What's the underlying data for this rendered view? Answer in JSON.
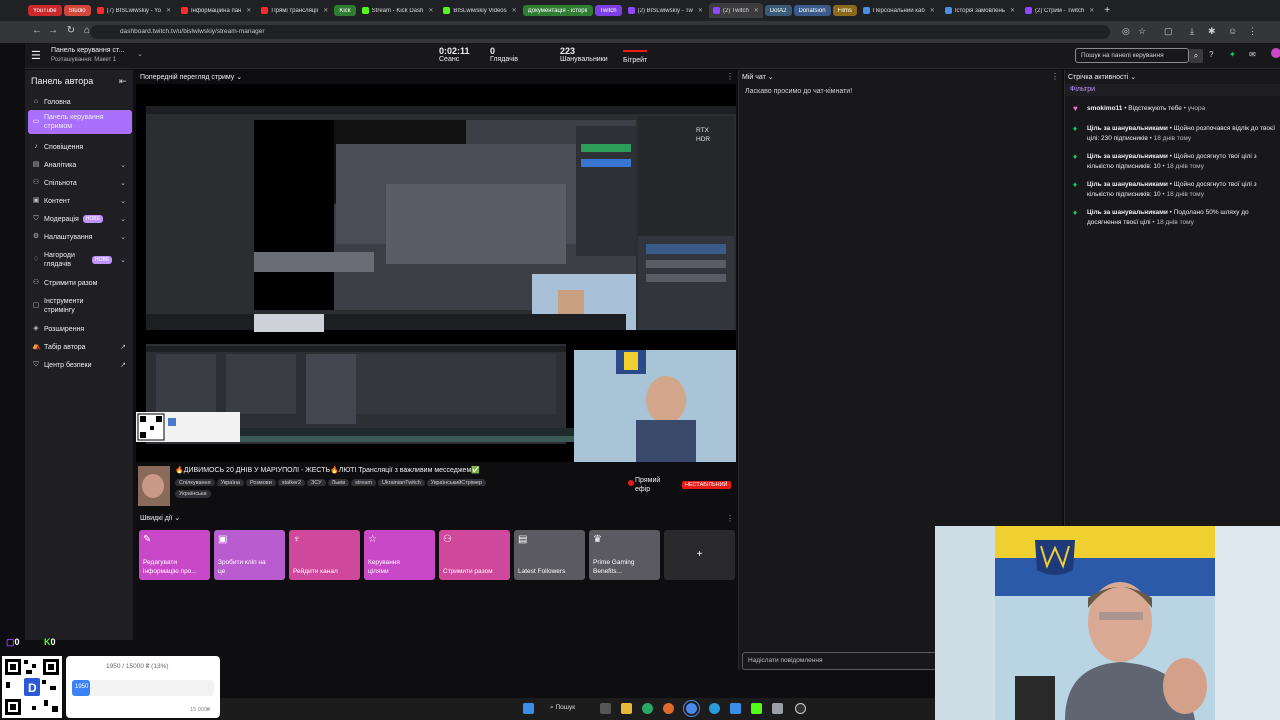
{
  "browser": {
    "tabs": [
      {
        "label": "YouTube",
        "pill": true,
        "color": "#cc2a2a"
      },
      {
        "label": "Studio",
        "pill": true,
        "color": "#d2463c"
      },
      {
        "label": "(7) BISLwiwskiy - Yo",
        "color": "#ff2a2a"
      },
      {
        "label": "Інформаційна пан",
        "color": "#ff2a2a"
      },
      {
        "label": "Прямі трансляції",
        "color": "#ff2a2a"
      },
      {
        "label": "Kick",
        "pill": true,
        "color": "#2e7d32"
      },
      {
        "label": "Stream - Kick Dash",
        "color": "#53fc18"
      },
      {
        "label": "BISLwiwskiy Videos",
        "color": "#53fc18"
      },
      {
        "label": "Документація - історії",
        "pill": true,
        "color": "#2e7d32"
      },
      {
        "label": "Twitch",
        "pill": true,
        "color": "#7b3fe4"
      },
      {
        "label": "(2) BISLwiwskiy - Tw",
        "color": "#9147ff"
      },
      {
        "label": "(2) Twitch",
        "color": "#9147ff",
        "active": true
      },
      {
        "label": "DotA2",
        "pill": true,
        "color": "#3a5a78"
      },
      {
        "label": "Donatsion",
        "pill": true,
        "color": "#3a5a8a"
      },
      {
        "label": "Films",
        "pill": true,
        "color": "#8a6a1a"
      },
      {
        "label": "Персональний каб",
        "color": "#4a90e2"
      },
      {
        "label": "Історія замовлень",
        "color": "#4a90e2"
      },
      {
        "label": "(2) Стрим - Twitch",
        "color": "#9147ff"
      }
    ],
    "url": "dashboard.twitch.tv/u/bislwiwskiy/stream-manager"
  },
  "header": {
    "panel_title": "Панель керування ст...",
    "layout": "Розташування: Макет 1",
    "stats": [
      {
        "value": "0:02:11",
        "label": "Сеанс"
      },
      {
        "value": "0",
        "label": "Глядачів"
      },
      {
        "value": "223",
        "label": "Шанувальники"
      },
      {
        "value": "",
        "label": "Бітрейт"
      }
    ],
    "search_placeholder": "Пошук на панелі керування"
  },
  "sidebar": {
    "title": "Панель автора",
    "items": [
      {
        "label": "Головна",
        "icon": "home-icon"
      },
      {
        "label": "Панель керування стримом",
        "icon": "stream-icon",
        "active": true
      },
      {
        "label": "Сповіщення",
        "icon": "bell-icon"
      },
      {
        "label": "Аналітика",
        "icon": "chart-icon",
        "chevron": true
      },
      {
        "label": "Спільнота",
        "icon": "people-icon",
        "chevron": true
      },
      {
        "label": "Контент",
        "icon": "content-icon",
        "chevron": true
      },
      {
        "label": "Модерація",
        "icon": "shield-icon",
        "chevron": true,
        "badge": "НОВЕ"
      },
      {
        "label": "Налаштування",
        "icon": "gear-icon",
        "chevron": true
      },
      {
        "label": "Нагороди глядачів",
        "icon": "reward-icon",
        "chevron": true,
        "badge": "НОВЕ"
      },
      {
        "label": "Стримити разом",
        "icon": "together-icon"
      },
      {
        "label": "Інструменти стримінгу",
        "icon": "tools-icon"
      },
      {
        "label": "Розширення",
        "icon": "extension-icon"
      },
      {
        "label": "Табір автора",
        "icon": "camp-icon",
        "external": true
      },
      {
        "label": "Центр безпеки",
        "icon": "safety-icon",
        "external": true
      }
    ]
  },
  "preview": {
    "heading": "Попередній перегляд стриму",
    "overlay_text": "RTX HDR"
  },
  "stream_info": {
    "title": "🔥ДИВИМОСЬ 20 ДНІВ У МАРІУПОЛІ - ЖЕСТЬ🔥ЛЮТІ Трансляції з важливим месседжем✅",
    "tags": [
      "Спілкування",
      "Україна",
      "Розмови",
      "stalker2",
      "ЗСУ",
      "Львів",
      "stream",
      "UkrainianTwitch",
      "УкраїнськийСтрімер"
    ],
    "language": "Українська",
    "live_label": "Прямий ефір",
    "unstable_label": "НЕСТАБІЛЬНИЙ"
  },
  "quick_actions": {
    "heading": "Швидкі дії",
    "items": [
      {
        "label": "Редагувати інформацію про...",
        "icon": "pencil-icon",
        "color": "#c848c8"
      },
      {
        "label": "Зробити кліп на це",
        "icon": "clip-icon",
        "color": "#b85cd0"
      },
      {
        "label": "Рейдити канал",
        "icon": "raid-icon",
        "color": "#d0489c"
      },
      {
        "label": "Керування цілями",
        "icon": "star-icon",
        "color": "#c848c8"
      },
      {
        "label": "Стримити разом",
        "icon": "together-icon",
        "color": "#d0489c"
      },
      {
        "label": "Latest Followers",
        "icon": "followers-icon",
        "color": "#5a5a60"
      },
      {
        "label": "Prime Gaming Benefits...",
        "icon": "prime-icon",
        "color": "#5a5a60"
      },
      {
        "label": "+",
        "icon": "plus-icon",
        "color": "#2a2a2d"
      }
    ]
  },
  "chat": {
    "heading": "Мій чат",
    "welcome": "Ласкаво просимо до чат-кімнати!",
    "input_placeholder": "Надіслати повідомлення"
  },
  "activity": {
    "heading": "Стрічка активності",
    "filters": "Фільтри",
    "items": [
      {
        "bold": "smokimo11",
        "text": " • Відстежують тебе",
        "time": " • учора",
        "icon": "heart-icon",
        "color": "#ff6ad5"
      },
      {
        "bold": "Ціль за шанувальниками",
        "text": " • Щойно розпочався відлік до твоєї цілі: 230 підписників",
        "time": " • 18 днів тому",
        "icon": "goal-icon",
        "color": "#00d36b"
      },
      {
        "bold": "Ціль за шанувальниками",
        "text": " • Щойно досягнуто твої цілі з кількістю підписників: 10",
        "time": " • 18 днів тому",
        "icon": "goal-icon",
        "color": "#00d36b"
      },
      {
        "bold": "Ціль за шанувальниками",
        "text": " • Щойно досягнуто твої цілі з кількістю підписників: 10",
        "time": " • 18 днів тому",
        "icon": "goal-icon",
        "color": "#00d36b"
      },
      {
        "bold": "Ціль за шанувальниками",
        "text": " • Подолано 50% шляху до досягнення твоєї цілі",
        "time": " • 18 днів тому",
        "icon": "goal-icon",
        "color": "#00d36b"
      }
    ]
  },
  "overlay": {
    "twitch_count": "0",
    "kick_count": "0",
    "donation_progress": "1950 / 15000 ₴ (13%)",
    "donation_fill": 0.13,
    "donation_max": "15 000₴",
    "donation_current": "1950"
  },
  "taskbar": {
    "search_label": "Пошук"
  }
}
